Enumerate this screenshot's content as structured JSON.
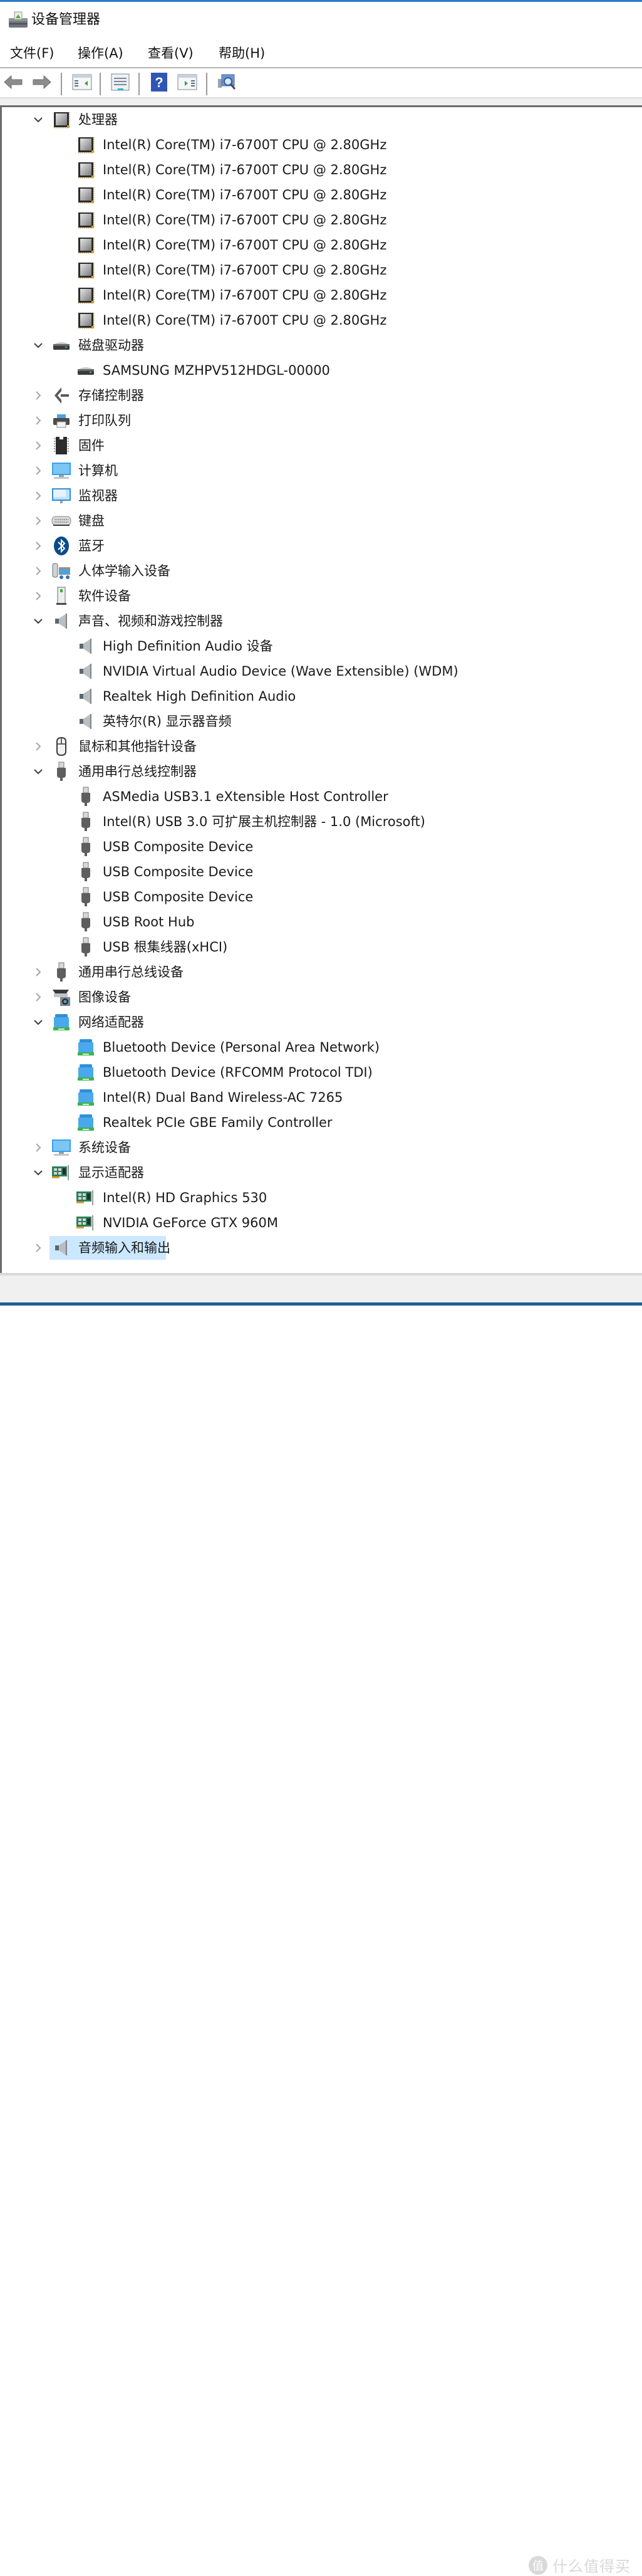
{
  "window": {
    "title": "设备管理器",
    "icon": "device-manager-icon"
  },
  "menu": {
    "items": [
      {
        "label": "文件(F)"
      },
      {
        "label": "操作(A)"
      },
      {
        "label": "查看(V)"
      },
      {
        "label": "帮助(H)"
      }
    ]
  },
  "toolbar": {
    "buttons": [
      {
        "name": "back",
        "icon": "arrow-left-icon"
      },
      {
        "name": "forward",
        "icon": "arrow-right-icon"
      },
      {
        "name": "show-hide-console-tree",
        "icon": "console-tree-icon"
      },
      {
        "name": "properties",
        "icon": "properties-icon"
      },
      {
        "name": "help",
        "icon": "help-icon"
      },
      {
        "name": "show-hide-action-pane",
        "icon": "action-pane-icon"
      },
      {
        "name": "scan-hardware-changes",
        "icon": "scan-hardware-icon"
      }
    ]
  },
  "tree": {
    "selected": "音频输入和输出",
    "rows": [
      {
        "level": 0,
        "expanded": true,
        "icon": "processor",
        "label": "处理器"
      },
      {
        "level": 1,
        "icon": "processor",
        "label": "Intel(R) Core(TM) i7-6700T CPU @ 2.80GHz"
      },
      {
        "level": 1,
        "icon": "processor",
        "label": "Intel(R) Core(TM) i7-6700T CPU @ 2.80GHz"
      },
      {
        "level": 1,
        "icon": "processor",
        "label": "Intel(R) Core(TM) i7-6700T CPU @ 2.80GHz"
      },
      {
        "level": 1,
        "icon": "processor",
        "label": "Intel(R) Core(TM) i7-6700T CPU @ 2.80GHz"
      },
      {
        "level": 1,
        "icon": "processor",
        "label": "Intel(R) Core(TM) i7-6700T CPU @ 2.80GHz"
      },
      {
        "level": 1,
        "icon": "processor",
        "label": "Intel(R) Core(TM) i7-6700T CPU @ 2.80GHz"
      },
      {
        "level": 1,
        "icon": "processor",
        "label": "Intel(R) Core(TM) i7-6700T CPU @ 2.80GHz"
      },
      {
        "level": 1,
        "icon": "processor",
        "label": "Intel(R) Core(TM) i7-6700T CPU @ 2.80GHz"
      },
      {
        "level": 0,
        "expanded": true,
        "icon": "disk",
        "label": "磁盘驱动器"
      },
      {
        "level": 1,
        "icon": "disk",
        "label": "SAMSUNG MZHPV512HDGL-00000"
      },
      {
        "level": 0,
        "expanded": false,
        "icon": "storage-controller",
        "label": "存储控制器"
      },
      {
        "level": 0,
        "expanded": false,
        "icon": "printer",
        "label": "打印队列"
      },
      {
        "level": 0,
        "expanded": false,
        "icon": "firmware",
        "label": "固件"
      },
      {
        "level": 0,
        "expanded": false,
        "icon": "computer",
        "label": "计算机"
      },
      {
        "level": 0,
        "expanded": false,
        "icon": "monitor",
        "label": "监视器"
      },
      {
        "level": 0,
        "expanded": false,
        "icon": "keyboard",
        "label": "键盘"
      },
      {
        "level": 0,
        "expanded": false,
        "icon": "bluetooth",
        "label": "蓝牙"
      },
      {
        "level": 0,
        "expanded": false,
        "icon": "hid",
        "label": "人体学输入设备"
      },
      {
        "level": 0,
        "expanded": false,
        "icon": "software-device",
        "label": "软件设备"
      },
      {
        "level": 0,
        "expanded": true,
        "icon": "speaker",
        "label": "声音、视频和游戏控制器"
      },
      {
        "level": 1,
        "icon": "speaker",
        "label": "High Definition Audio 设备"
      },
      {
        "level": 1,
        "icon": "speaker",
        "label": "NVIDIA Virtual Audio Device (Wave Extensible) (WDM)"
      },
      {
        "level": 1,
        "icon": "speaker",
        "label": "Realtek High Definition Audio"
      },
      {
        "level": 1,
        "icon": "speaker",
        "label": "英特尔(R) 显示器音频"
      },
      {
        "level": 0,
        "expanded": false,
        "icon": "mouse",
        "label": "鼠标和其他指针设备"
      },
      {
        "level": 0,
        "expanded": true,
        "icon": "usb",
        "label": "通用串行总线控制器"
      },
      {
        "level": 1,
        "icon": "usb",
        "label": "ASMedia USB3.1 eXtensible Host Controller"
      },
      {
        "level": 1,
        "icon": "usb",
        "label": "Intel(R) USB 3.0 可扩展主机控制器 - 1.0 (Microsoft)"
      },
      {
        "level": 1,
        "icon": "usb",
        "label": "USB Composite Device"
      },
      {
        "level": 1,
        "icon": "usb",
        "label": "USB Composite Device"
      },
      {
        "level": 1,
        "icon": "usb",
        "label": "USB Composite Device"
      },
      {
        "level": 1,
        "icon": "usb",
        "label": "USB Root Hub"
      },
      {
        "level": 1,
        "icon": "usb",
        "label": "USB 根集线器(xHCI)"
      },
      {
        "level": 0,
        "expanded": false,
        "icon": "usb",
        "label": "通用串行总线设备"
      },
      {
        "level": 0,
        "expanded": false,
        "icon": "imaging",
        "label": "图像设备"
      },
      {
        "level": 0,
        "expanded": true,
        "icon": "network",
        "label": "网络适配器"
      },
      {
        "level": 1,
        "icon": "network",
        "label": "Bluetooth Device (Personal Area Network)"
      },
      {
        "level": 1,
        "icon": "network",
        "label": "Bluetooth Device (RFCOMM Protocol TDI)"
      },
      {
        "level": 1,
        "icon": "network",
        "label": "Intel(R) Dual Band Wireless-AC 7265"
      },
      {
        "level": 1,
        "icon": "network",
        "label": "Realtek PCIe GBE Family Controller"
      },
      {
        "level": 0,
        "expanded": false,
        "icon": "computer",
        "label": "系统设备"
      },
      {
        "level": 0,
        "expanded": true,
        "icon": "display-adapter",
        "label": "显示适配器"
      },
      {
        "level": 1,
        "icon": "display-adapter",
        "label": "Intel(R) HD Graphics 530"
      },
      {
        "level": 1,
        "icon": "display-adapter",
        "label": "NVIDIA GeForce GTX 960M"
      },
      {
        "level": 0,
        "expanded": false,
        "icon": "speaker",
        "label": "音频输入和输出",
        "selected": true
      }
    ]
  },
  "watermark": {
    "badge": "值",
    "text": "什么值得买"
  },
  "colors": {
    "accent": "#2b7bc0",
    "selection": "#cce8ff",
    "text": "#1a1a1a"
  }
}
